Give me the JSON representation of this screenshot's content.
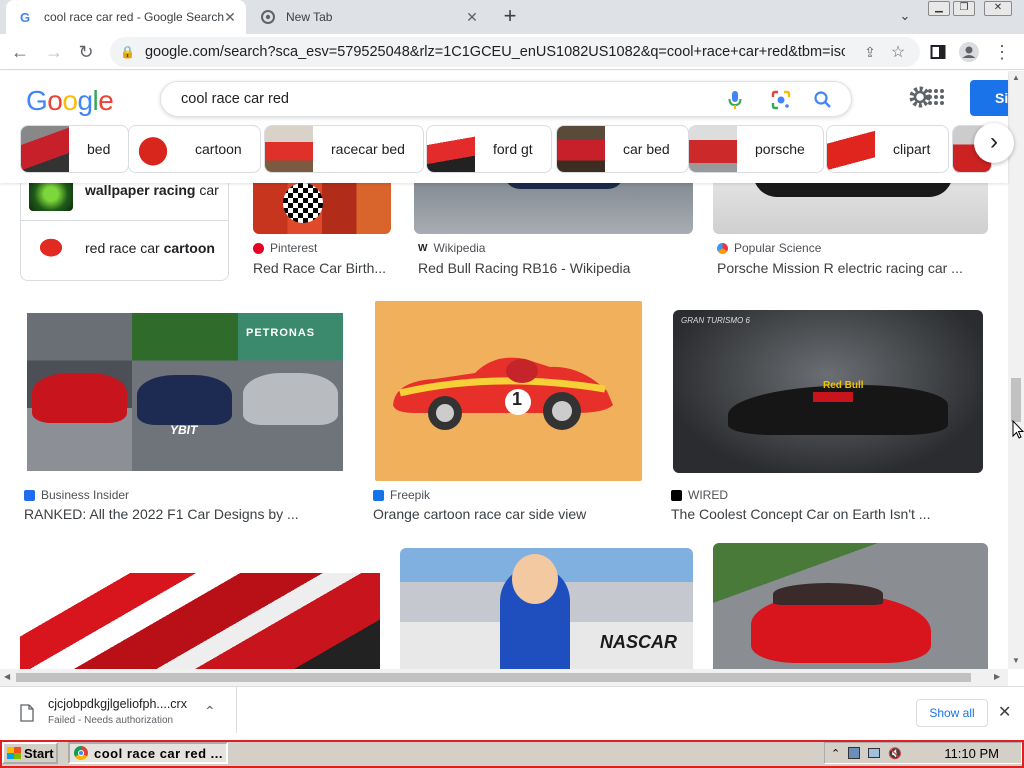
{
  "browser": {
    "tabs": [
      {
        "title": "cool race car red - Google Search",
        "active": true
      },
      {
        "title": "New Tab",
        "active": false
      }
    ],
    "new_tab_symbol": "+",
    "url": "google.com/search?sca_esv=579525048&rlz=1C1GCEU_enUS1082US1082&q=cool+race+car+red&tbm=isch&s..."
  },
  "google": {
    "logo": "Google",
    "query": "cool race car red",
    "signin_label": "Si",
    "chips": [
      {
        "label": "bed"
      },
      {
        "label": "cartoon"
      },
      {
        "label": "racecar bed"
      },
      {
        "label": "ford gt"
      },
      {
        "label": "car bed"
      },
      {
        "label": "porsche"
      },
      {
        "label": "clipart"
      }
    ]
  },
  "related": [
    {
      "pre": "",
      "bold": "wallpaper racing",
      "post": " car"
    },
    {
      "pre": "red race car ",
      "bold": "cartoon",
      "post": ""
    }
  ],
  "results": [
    {
      "source": "Pinterest",
      "title": "Red Race Car Birth..."
    },
    {
      "source": "Wikipedia",
      "title": "Red Bull Racing RB16 - Wikipedia"
    },
    {
      "source": "Popular Science",
      "title": "Porsche Mission R electric racing car ..."
    },
    {
      "source": "Business Insider",
      "title": "RANKED: All the 2022 F1 Car Designs by ..."
    },
    {
      "source": "Freepik",
      "title": "Orange cartoon race car side view"
    },
    {
      "source": "WIRED",
      "title": "The Coolest Concept Car on Earth Isn't ..."
    }
  ],
  "image_text": {
    "car_number": "1",
    "nascar": "NASCAR",
    "redbull": "Red Bull",
    "gt": "GRAN TURISMO 6",
    "ybit": "YBIT",
    "petronas": "PETRONAS"
  },
  "download": {
    "filename": "cjcjobpdkgjlgeliofph....crx",
    "status": "Failed - Needs authorization",
    "show_all": "Show all"
  },
  "taskbar": {
    "start": "Start",
    "window_title": "cool race car red ...",
    "time": "11:10 PM"
  }
}
